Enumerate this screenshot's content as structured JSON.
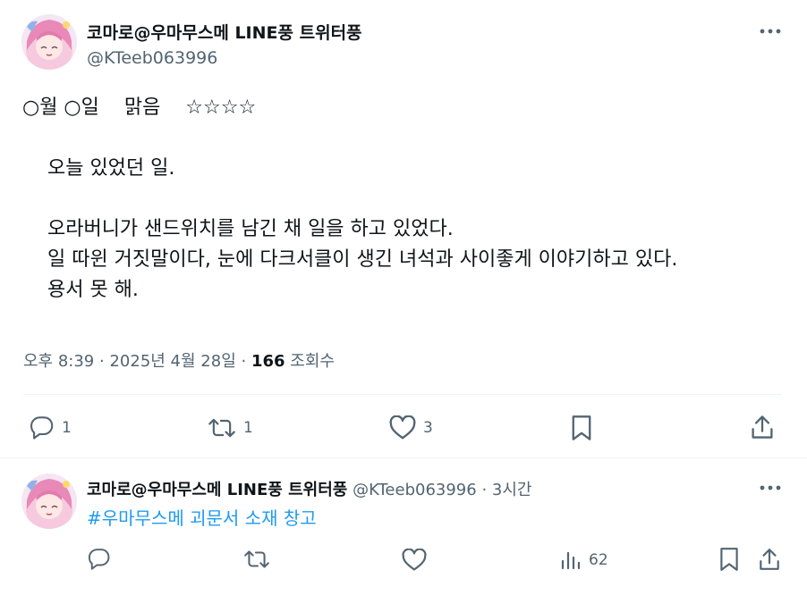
{
  "main_post": {
    "author_name": "코마로@우마무스메 LINE풍 트위터풍",
    "author_handle": "@KTeeb063996",
    "text": "○월 ○일    맑음    ☆☆☆☆\n\n    오늘 있었던 일.\n\n    오라버니가 샌드위치를 남긴 채 일을 하고 있었다.\n    일 따윈 거짓말이다, 눈에 다크서클이 생긴 녀석과 사이좋게 이야기하고 있다.\n    용서 못 해.",
    "time": "오후 8:39",
    "date": "2025년 4월 28일",
    "views_count": "166",
    "views_label": "조회수",
    "meta_sep": "·",
    "actions": {
      "reply_count": "1",
      "retweet_count": "1",
      "like_count": "3"
    }
  },
  "reply_post": {
    "author_name": "코마로@우마무스메 LINE풍 트위터풍",
    "author_handle": "@KTeeb063996",
    "age": "3시간",
    "text": "#우마무스메 괴문서 소재 창고",
    "actions": {
      "views_count": "62"
    }
  },
  "colors": {
    "text_primary": "#0f1419",
    "text_secondary": "#536471",
    "link": "#1d9bf0",
    "divider": "#eff3f4",
    "avatar_bg": "#f4d8ea"
  },
  "icons": [
    "more-icon",
    "reply-icon",
    "retweet-icon",
    "like-icon",
    "bookmark-icon",
    "share-icon",
    "views-icon"
  ]
}
